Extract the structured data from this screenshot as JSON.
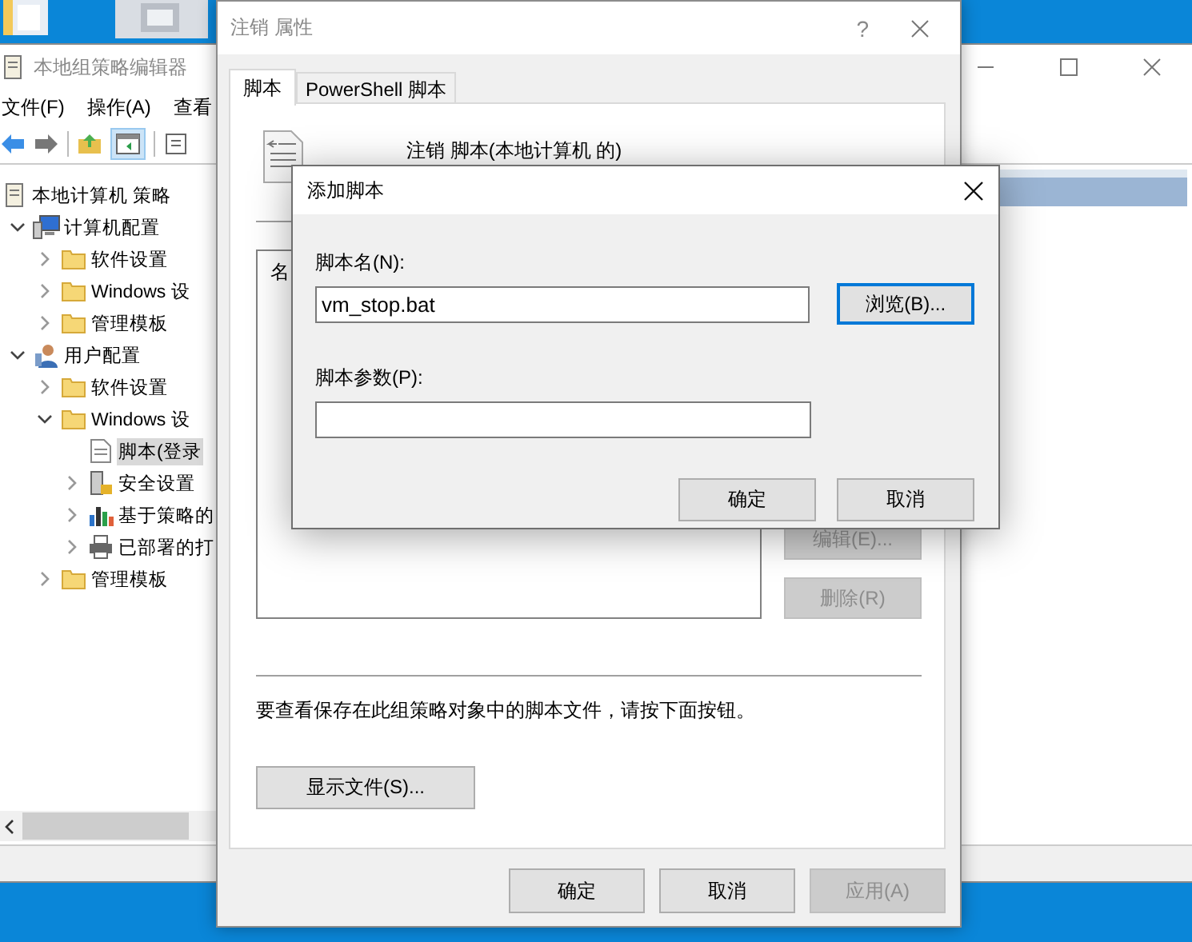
{
  "editor_window": {
    "title": "本地组策略编辑器",
    "menu": [
      "文件(F)",
      "操作(A)",
      "查看"
    ],
    "tree": [
      {
        "label": "本地计算机 策略",
        "kind": "policy",
        "selected": false,
        "children": [
          {
            "label": "计算机配置",
            "kind": "computer",
            "selected": false,
            "expanded": true,
            "children": [
              {
                "label": "软件设置",
                "kind": "folder",
                "selected": false,
                "expanded": false
              },
              {
                "label": "Windows 设",
                "kind": "folder",
                "selected": false,
                "expanded": false
              },
              {
                "label": "管理模板",
                "kind": "folder",
                "selected": false,
                "expanded": false
              }
            ]
          },
          {
            "label": "用户配置",
            "kind": "user",
            "selected": false,
            "expanded": true,
            "children": [
              {
                "label": "软件设置",
                "kind": "folder",
                "selected": false,
                "expanded": false
              },
              {
                "label": "Windows 设",
                "kind": "folder",
                "selected": false,
                "expanded": true,
                "children": [
                  {
                    "label": "脚本(登录",
                    "kind": "script",
                    "selected": true
                  },
                  {
                    "label": "安全设置",
                    "kind": "security",
                    "selected": false,
                    "expanded": false
                  },
                  {
                    "label": "基于策略的",
                    "kind": "chart",
                    "selected": false,
                    "expanded": false
                  },
                  {
                    "label": "已部署的打",
                    "kind": "printer",
                    "selected": false,
                    "expanded": false
                  }
                ]
              },
              {
                "label": "管理模板",
                "kind": "folder",
                "selected": false,
                "expanded": false
              }
            ]
          }
        ]
      }
    ]
  },
  "properties_dialog": {
    "title": "注销 属性",
    "help": "?",
    "tabs": [
      {
        "label": "脚本",
        "selected": true
      },
      {
        "label": "PowerShell 脚本",
        "selected": false
      }
    ],
    "heading": "注销 脚本(本地计算机 的)",
    "list_header": "名",
    "side_buttons": [
      {
        "label": "编辑(E)...",
        "disabled": true
      },
      {
        "label": "删除(R)",
        "disabled": true
      }
    ],
    "note": "要查看保存在此组策略对象中的脚本文件，请按下面按钮。",
    "show_files_button": "显示文件(S)...",
    "buttons": [
      {
        "label": "确定",
        "disabled": false
      },
      {
        "label": "取消",
        "disabled": false
      },
      {
        "label": "应用(A)",
        "disabled": true
      }
    ]
  },
  "add_script_dialog": {
    "title": "添加脚本",
    "fields": [
      {
        "label": "脚本名(N):",
        "value": "vm_stop.bat"
      },
      {
        "label": "脚本参数(P):"
      }
    ],
    "browse_button": {
      "label": "浏览(B)...",
      "focused": true
    },
    "buttons": [
      "确定",
      "取消"
    ]
  }
}
